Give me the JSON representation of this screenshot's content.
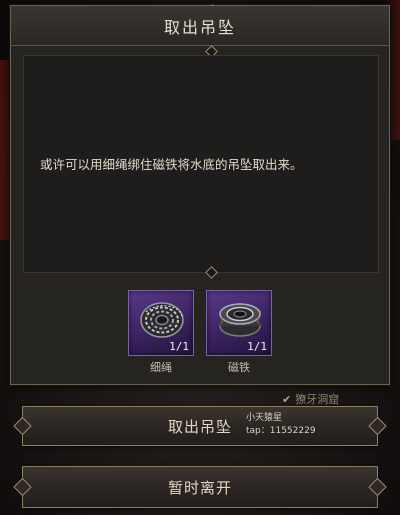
{
  "dialog": {
    "title": "取出吊坠",
    "description": "或许可以用细绳绑住磁铁将水底的吊坠取出来。"
  },
  "items": [
    {
      "name": "细绳",
      "count": "1/1",
      "icon": "rope-coil-icon",
      "rarity_color": "#5a3a8a"
    },
    {
      "name": "磁铁",
      "count": "1/1",
      "icon": "magnet-icon",
      "rarity_color": "#5a3a8a"
    }
  ],
  "location_tag": {
    "label": "獠牙洞窟",
    "icon": "check-icon"
  },
  "buttons": {
    "primary_label": "取出吊坠",
    "secondary_label": "暂时离开"
  },
  "watermark": {
    "name": "小天猿星",
    "tap": "tap：11552229"
  }
}
